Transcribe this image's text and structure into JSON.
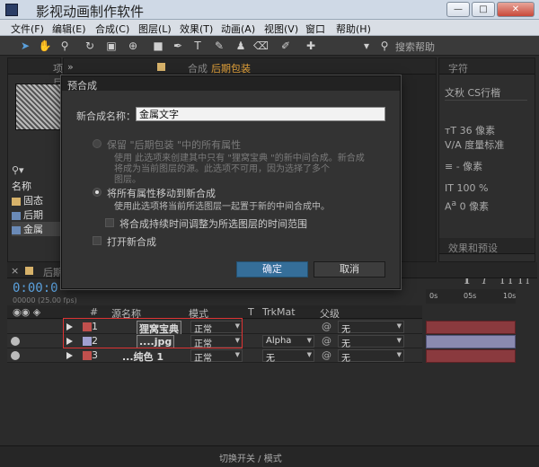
{
  "window": {
    "title": "影视动画制作软件",
    "minimize": "—",
    "maximize": "□",
    "close": "✕"
  },
  "menu": [
    "文件(F)",
    "编辑(E)",
    "合成(C)",
    "图层(L)",
    "效果(T)",
    "动画(A)",
    "视图(V)",
    "窗口",
    "帮助(H)"
  ],
  "toolbar": {
    "search_label": "搜索帮助"
  },
  "project_panel": {
    "tab": "项目",
    "column_name": "名称",
    "items": [
      "固态",
      "后期",
      "金属"
    ]
  },
  "comp_panel": {
    "tab_prefix": "合成",
    "tab_name": "后期包装"
  },
  "character_panel": {
    "tab": "字符",
    "font": "文秋 CS行楷",
    "size": "36 像素",
    "kerning": "度量标准",
    "stroke_width": "- 像素",
    "vert_scale": "100 %",
    "baseline": "0 像素",
    "effects_tab": "效果和预设"
  },
  "timeline": {
    "tab": "后期",
    "timecode": "0:00:0",
    "fps": "00000 (25.00 fps)",
    "columns": {
      "hash": "#",
      "source": "源名称",
      "mode": "模式",
      "t": "T",
      "trkmat": "TrkMat",
      "parent": "父级"
    },
    "ruler": [
      "0s",
      "05s",
      "10s"
    ],
    "layers": [
      {
        "num": "1",
        "name": "狸窝宝典",
        "mode": "正常",
        "trkmat": "",
        "parent": "无",
        "color": "#c0504d"
      },
      {
        "num": "2",
        "name": "....jpg",
        "mode": "正常",
        "trkmat": "Alpha",
        "parent": "无",
        "color": "#a0a0d0"
      },
      {
        "num": "3",
        "name": "...纯色 1",
        "mode": "正常",
        "trkmat": "无",
        "parent": "无",
        "color": "#c0504d"
      }
    ],
    "status": "切换开关 / 模式"
  },
  "dialog": {
    "title": "预合成",
    "name_label": "新合成名称：",
    "name_value": "金属文字",
    "option1_label": "保留 \"后期包装 \"中的所有属性",
    "option1_desc1": "使用 此选项来创建其中只有 \"狸窝宝典 \"的新中间合成。新合成",
    "option1_desc2": "将成为当前图层的源。此选项不可用，因为选择了多个",
    "option1_desc3": "图层。",
    "option2_label": "将所有属性移动到新合成",
    "option2_desc": "使用此选项将当前所选图层一起置于新的中间合成中。",
    "adjust_label": "将合成持续时间调整为所选图层的时间范围",
    "open_label": "打开新合成",
    "ok": "确定",
    "cancel": "取消"
  }
}
